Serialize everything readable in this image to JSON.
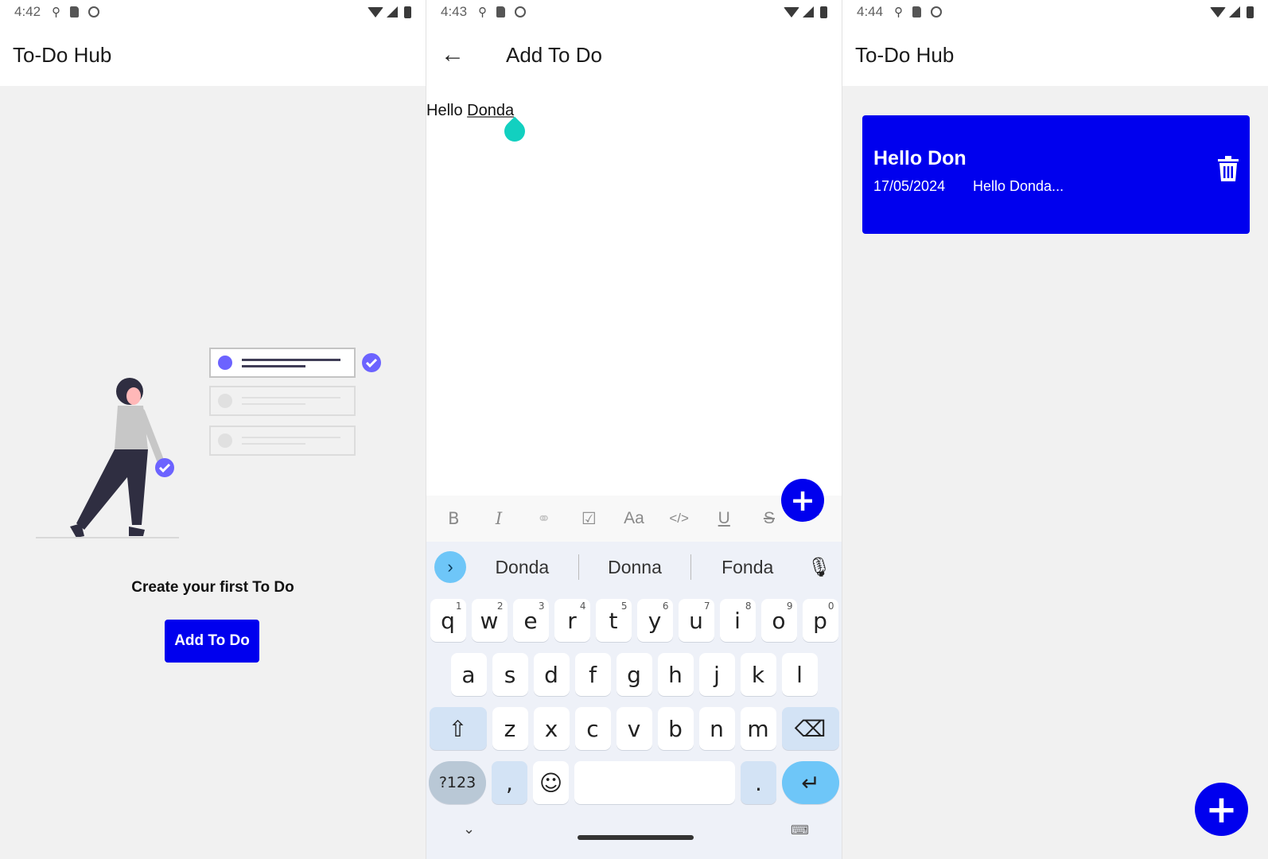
{
  "screen1": {
    "status_time": "4:42",
    "app_title": "To-Do Hub",
    "empty_message": "Create your first To Do",
    "add_button_label": "Add To Do"
  },
  "screen2": {
    "status_time": "4:43",
    "app_title": "Add To Do",
    "editor_text_plain": "Hello ",
    "editor_text_underlined": "Donda",
    "toolbar": {
      "bold": "B",
      "italic": "I",
      "link": "⚭",
      "checkbox": "☑",
      "font_size": "Aa",
      "code": "</>",
      "underline": "U",
      "strikethrough": "S",
      "quote": "“”"
    },
    "keyboard": {
      "suggestions": [
        "Donda",
        "Donna",
        "Fonda"
      ],
      "row1": [
        [
          "q",
          "1"
        ],
        [
          "w",
          "2"
        ],
        [
          "e",
          "3"
        ],
        [
          "r",
          "4"
        ],
        [
          "t",
          "5"
        ],
        [
          "y",
          "6"
        ],
        [
          "u",
          "7"
        ],
        [
          "i",
          "8"
        ],
        [
          "o",
          "9"
        ],
        [
          "p",
          "0"
        ]
      ],
      "row2": [
        "a",
        "s",
        "d",
        "f",
        "g",
        "h",
        "j",
        "k",
        "l"
      ],
      "row3": [
        "z",
        "x",
        "c",
        "v",
        "b",
        "n",
        "m"
      ],
      "symbols_key": "?123",
      "comma_key": ",",
      "period_key": "."
    }
  },
  "screen3": {
    "status_time": "4:44",
    "app_title": "To-Do Hub",
    "todo": {
      "title": "Hello Don",
      "date": "17/05/2024",
      "preview": "Hello Donda..."
    }
  },
  "colors": {
    "primary": "#0000ee",
    "accent_teal": "#12d0c0",
    "illustration_purple": "#6c63ff"
  }
}
